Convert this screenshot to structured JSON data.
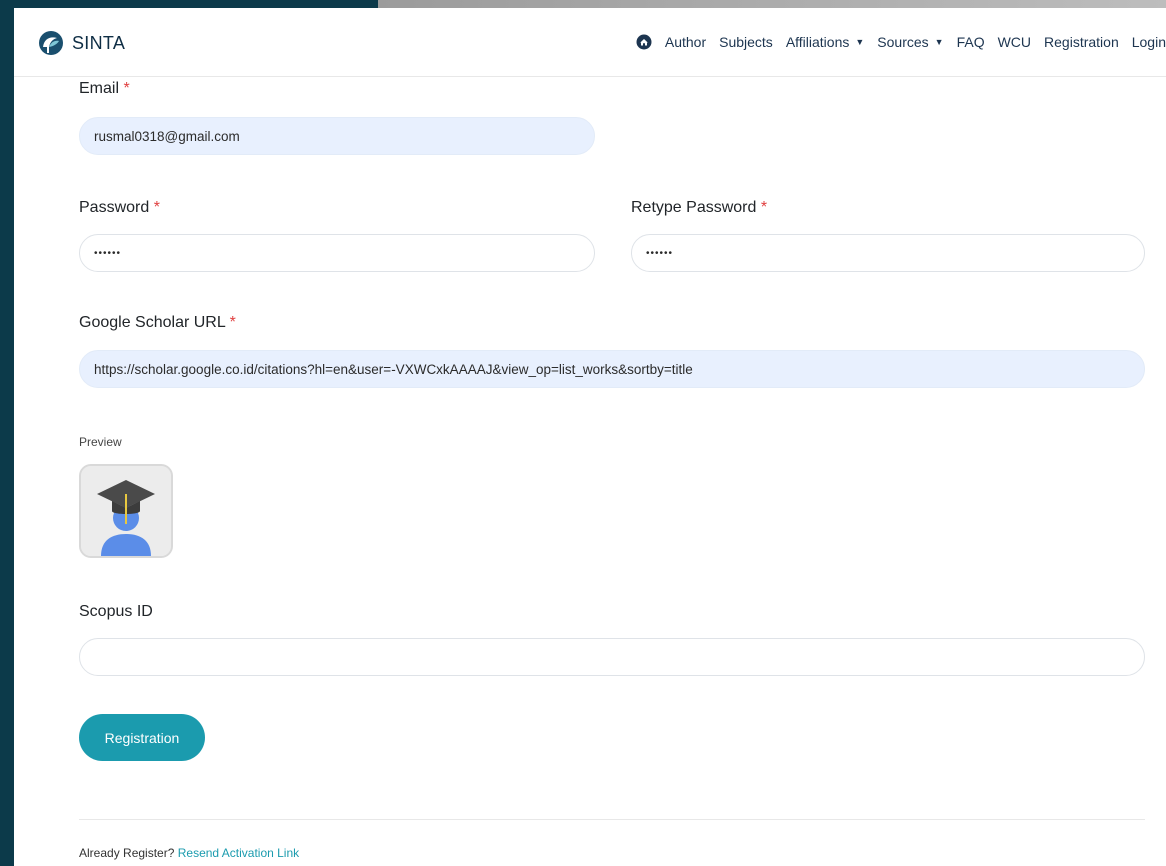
{
  "navbar": {
    "brand": "SINTA",
    "home_icon": "home-icon",
    "items": [
      {
        "label": "Author",
        "dropdown": false
      },
      {
        "label": "Subjects",
        "dropdown": false
      },
      {
        "label": "Affiliations",
        "dropdown": true
      },
      {
        "label": "Sources",
        "dropdown": true
      },
      {
        "label": "FAQ",
        "dropdown": false
      },
      {
        "label": "WCU",
        "dropdown": false
      },
      {
        "label": "Registration",
        "dropdown": false
      },
      {
        "label": "Login",
        "dropdown": false
      }
    ]
  },
  "form": {
    "email": {
      "label": "Email",
      "required_mark": "*",
      "value": "rusmal0318@gmail.com"
    },
    "password": {
      "label": "Password",
      "required_mark": "*",
      "value": "••••••"
    },
    "retype_password": {
      "label": "Retype Password",
      "required_mark": "*",
      "value": "••••••"
    },
    "google_scholar_url": {
      "label": "Google Scholar URL",
      "required_mark": "*",
      "value": "https://scholar.google.co.id/citations?hl=en&user=-VXWCxkAAAAJ&view_op=list_works&sortby=title"
    },
    "preview": {
      "label": "Preview",
      "icon": "graduate-avatar-icon"
    },
    "scopus_id": {
      "label": "Scopus ID",
      "value": ""
    },
    "submit_label": "Registration"
  },
  "footer": {
    "text": "Already Register?",
    "link": "Resend Activation Link"
  },
  "colors": {
    "accent": "#1b9bae",
    "brand_dark": "#0c3a4a",
    "required": "#e04040",
    "autofill_bg": "#e8f0fe"
  }
}
